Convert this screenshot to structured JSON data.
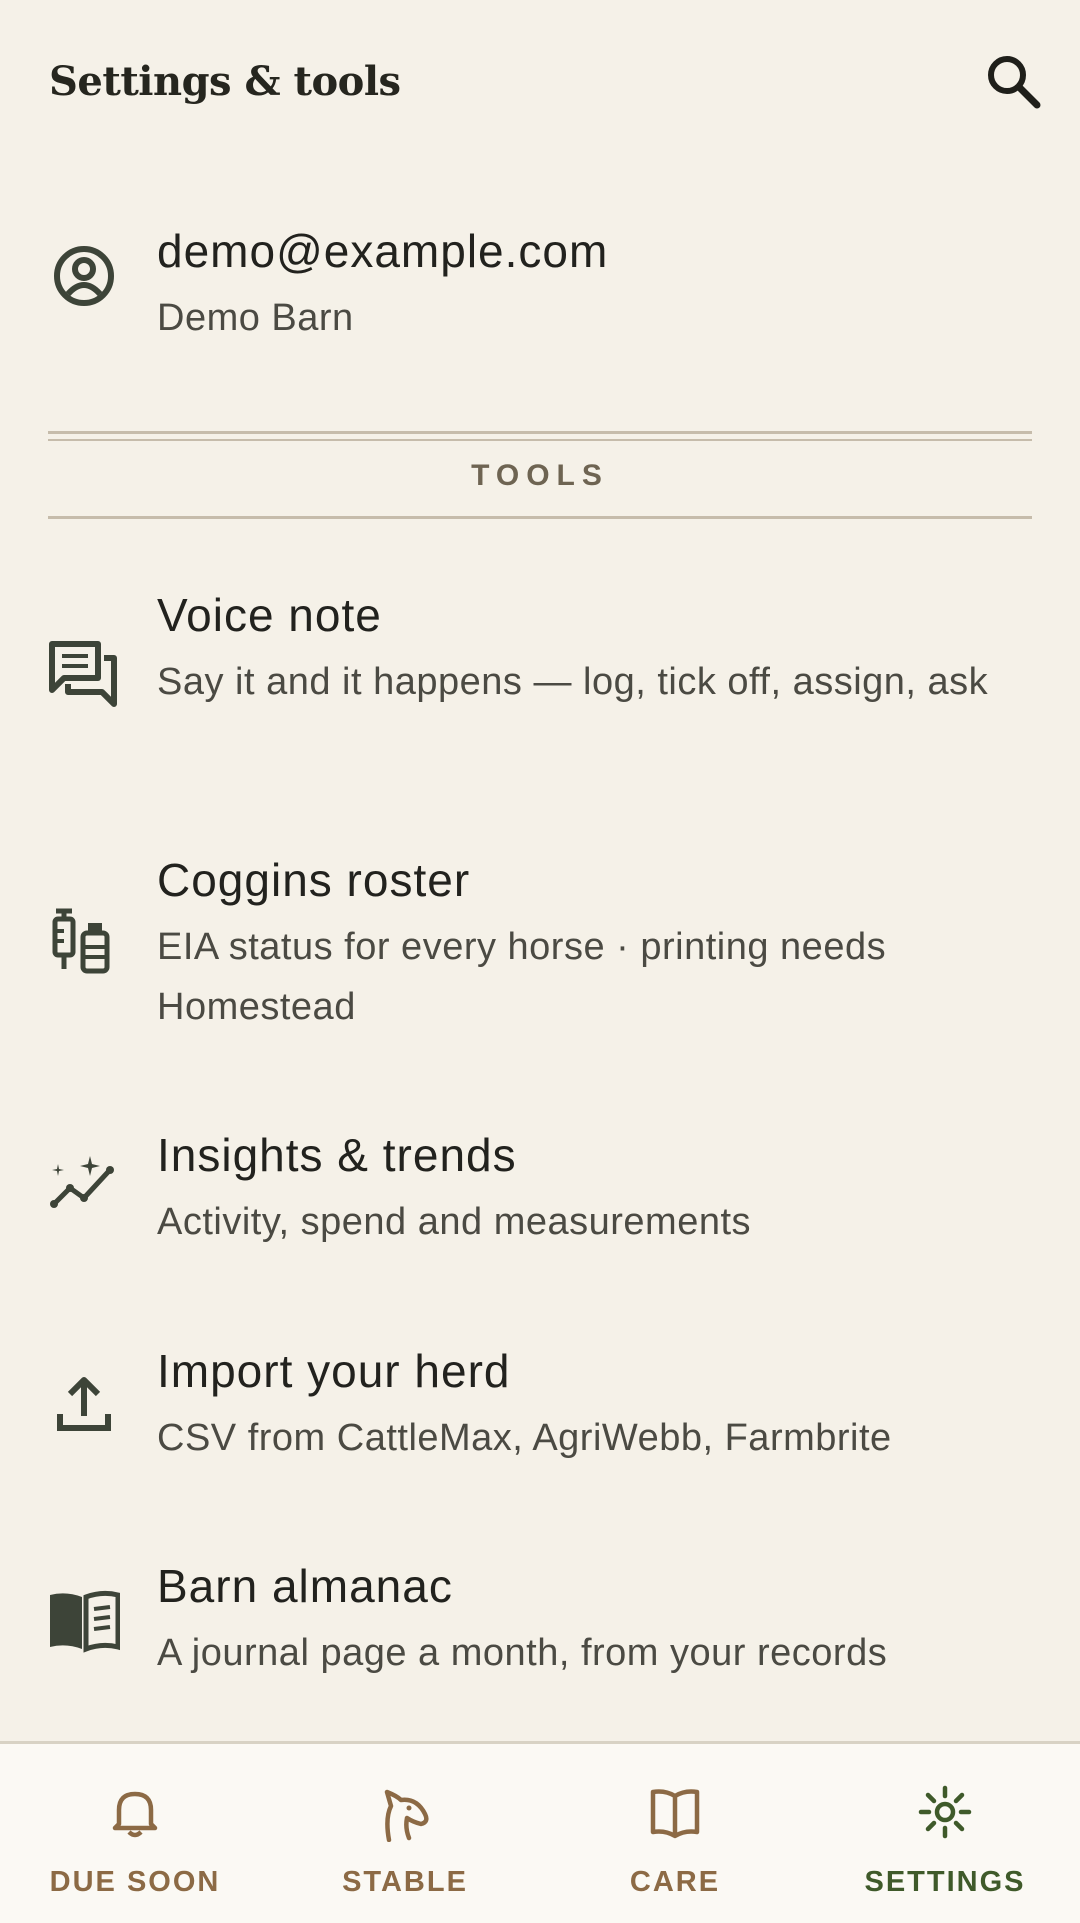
{
  "header": {
    "title": "Settings & tools"
  },
  "account": {
    "email": "demo@example.com",
    "barn": "Demo Barn"
  },
  "tools_section": {
    "label": "TOOLS"
  },
  "tools": [
    {
      "icon": "chat-bubbles-icon",
      "title": "Voice note",
      "subtitle": "Say it and it happens — log, tick off, assign, ask"
    },
    {
      "icon": "syringe-vial-icon",
      "title": "Coggins roster",
      "subtitle": "EIA status for every horse · printing needs Homestead"
    },
    {
      "icon": "sparkle-trend-icon",
      "title": "Insights & trends",
      "subtitle": "Activity, spend and measurements"
    },
    {
      "icon": "upload-icon",
      "title": "Import your herd",
      "subtitle": "CSV from CattleMax, AgriWebb, Farmbrite"
    },
    {
      "icon": "open-book-icon",
      "title": "Barn almanac",
      "subtitle": "A journal page a month, from your records"
    }
  ],
  "nav": {
    "items": [
      {
        "label": "DUE SOON",
        "icon": "bell-icon"
      },
      {
        "label": "STABLE",
        "icon": "horse-head-icon"
      },
      {
        "label": "CARE",
        "icon": "book-icon"
      },
      {
        "label": "SETTINGS",
        "icon": "gear-icon",
        "active": true
      }
    ]
  },
  "colors": {
    "background": "#f5f1e8",
    "nav_inactive": "#8c6a45",
    "nav_active": "#3f5a2a",
    "divider": "#c6bcab"
  }
}
